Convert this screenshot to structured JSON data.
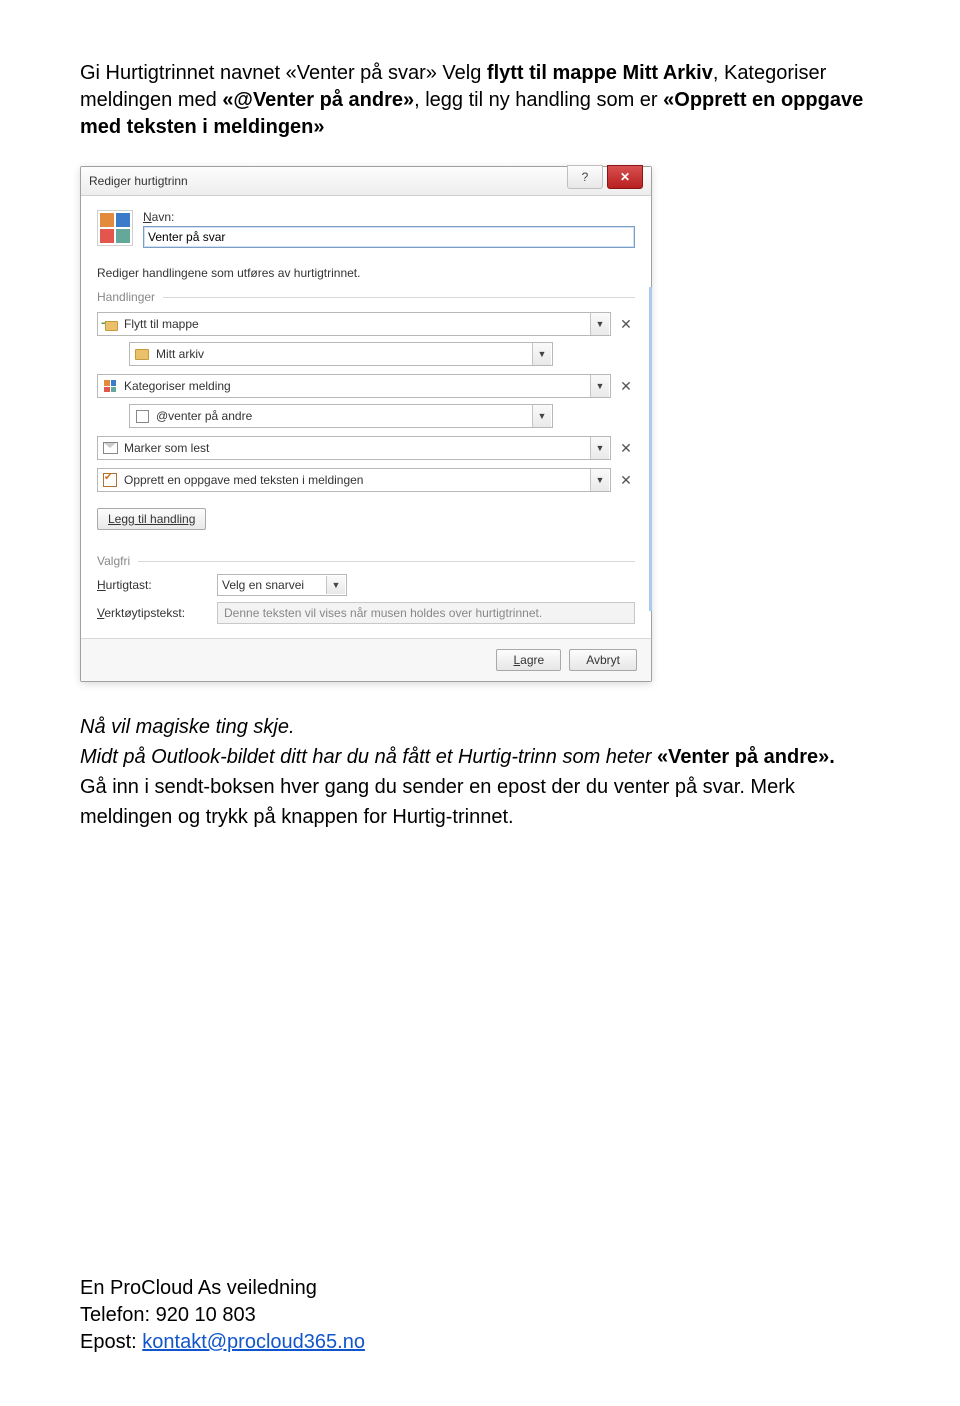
{
  "intro": {
    "line1_a": "Gi Hurtigtrinnet navnet «Venter på svar» Velg ",
    "line1_b": "flytt til mappe Mitt Arkiv",
    "line1_c": ", Kategoriser meldingen med ",
    "line1_d": "«@Venter på andre»",
    "line1_e": ", legg til ny handling som er ",
    "line1_f": "«Opprett en oppgave med teksten i meldingen»"
  },
  "dialog": {
    "title": "Rediger hurtigtrinn",
    "help": "?",
    "close": "✕",
    "name_label_pre": "N",
    "name_label_post": "avn:",
    "name_value": "Venter på svar",
    "sub_desc": "Rediger handlingene som utføres av hurtigtrinnet.",
    "section_actions": "Handlinger",
    "actions": {
      "a1": "Flytt til mappe",
      "a1_sub": "Mitt arkiv",
      "a2": "Kategoriser melding",
      "a2_sub": "@venter på andre",
      "a3": "Marker som lest",
      "a4": "Opprett en oppgave med teksten i meldingen"
    },
    "add_action": "Legg til handling",
    "section_optional": "Valgfri",
    "hotkey_label_u": "H",
    "hotkey_label_rest": "urtigtast:",
    "hotkey_value": "Velg en snarvei",
    "tooltip_label_u": "V",
    "tooltip_label_rest": "erktøytipstekst:",
    "tooltip_placeholder": "Denne teksten vil vises når musen holdes over hurtigtrinnet.",
    "footer": {
      "save_u": "L",
      "save_rest": "agre",
      "cancel": "Avbryt"
    }
  },
  "after": {
    "l1": "Nå vil magiske ting skje.",
    "l2_a": "Midt på Outlook-bildet ditt har du nå fått et Hurtig-trinn som heter ",
    "l2_b": "«Venter på andre».",
    "l3": "Gå inn i sendt-boksen hver gang du sender en epost der du venter på svar. Merk meldingen og trykk på knappen for Hurtig-trinnet."
  },
  "footer": {
    "l1": "En ProCloud As veiledning",
    "l2": "Telefon: 920 10 803",
    "l3_a": "Epost: ",
    "l3_b": "kontakt@procloud365.no"
  }
}
